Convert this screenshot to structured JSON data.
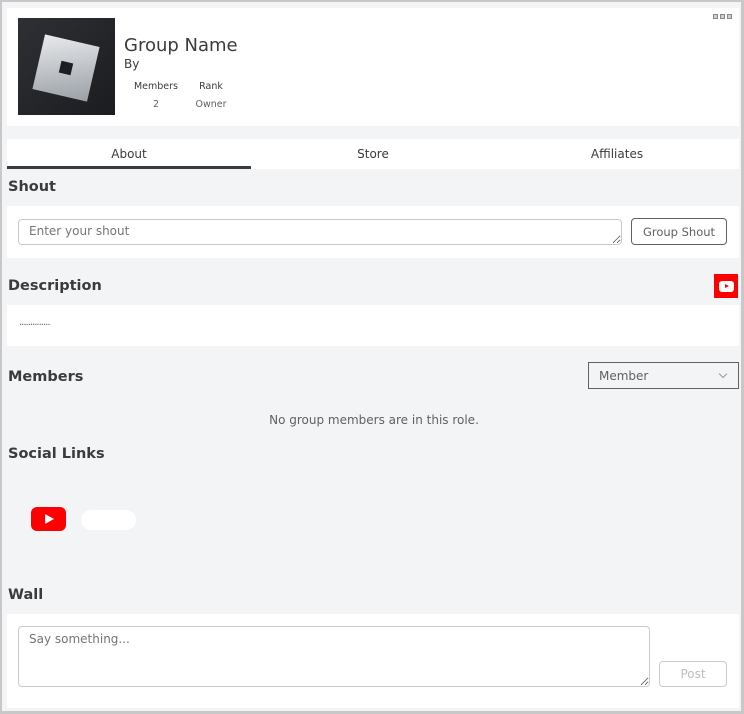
{
  "header": {
    "group_name": "Group Name",
    "by_label": "By",
    "stats": [
      {
        "label": "Members",
        "value": "2"
      },
      {
        "label": "Rank",
        "value": "Owner"
      }
    ],
    "more_icon": "more-options-icon"
  },
  "tabs": [
    {
      "label": "About",
      "active": true
    },
    {
      "label": "Store",
      "active": false
    },
    {
      "label": "Affiliates",
      "active": false
    }
  ],
  "shout": {
    "title": "Shout",
    "placeholder": "Enter your shout",
    "button_label": "Group Shout"
  },
  "description": {
    "title": "Description",
    "text": "..............",
    "social_icon": "youtube-icon",
    "icon_color": "#ff0000"
  },
  "members": {
    "title": "Members",
    "role_selected": "Member",
    "empty_message": "No group members are in this role."
  },
  "social_links": {
    "title": "Social Links",
    "items": [
      {
        "icon": "youtube-icon",
        "label": ""
      }
    ]
  },
  "wall": {
    "title": "Wall",
    "placeholder": "Say something...",
    "post_label": "Post"
  }
}
